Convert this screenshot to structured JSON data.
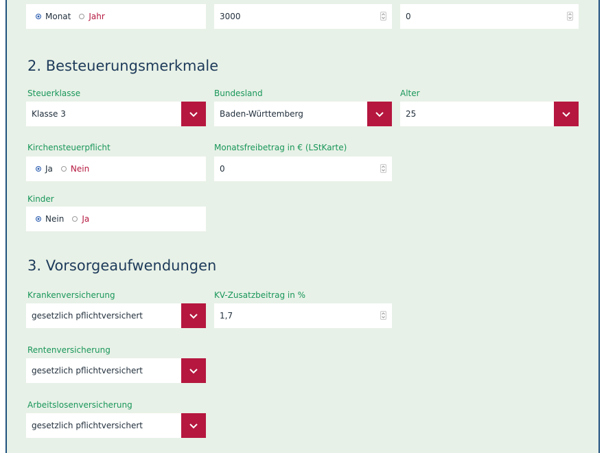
{
  "section1": {
    "period": {
      "options": [
        "Monat",
        "Jahr"
      ],
      "selected": "Monat"
    },
    "salary": "3000",
    "other": "0"
  },
  "section2": {
    "title": "2. Besteuerungsmerkmale",
    "steuerklasse": {
      "label": "Steuerklasse",
      "value": "Klasse 3"
    },
    "bundesland": {
      "label": "Bundesland",
      "value": "Baden-Württemberg"
    },
    "alter": {
      "label": "Alter",
      "value": "25"
    },
    "kirchensteuer": {
      "label": "Kirchensteuerpflicht",
      "options": [
        "Ja",
        "Nein"
      ],
      "selected": "Ja"
    },
    "freibetrag": {
      "label": "Monatsfreibetrag in € (LStKarte)",
      "value": "0"
    },
    "kinder": {
      "label": "Kinder",
      "options": [
        "Nein",
        "Ja"
      ],
      "selected": "Nein"
    }
  },
  "section3": {
    "title": "3. Vorsorgeaufwendungen",
    "kranken": {
      "label": "Krankenversicherung",
      "value": "gesetzlich pflichtversichert"
    },
    "kvzusatz": {
      "label": "KV-Zusatzbeitrag in %",
      "value": "1,7"
    },
    "renten": {
      "label": "Rentenversicherung",
      "value": "gesetzlich pflichtversichert"
    },
    "arbeitslosen": {
      "label": "Arbeitslosenversicherung",
      "value": "gesetzlich pflichtversichert"
    }
  },
  "colors": {
    "accent": "#b5173f",
    "label": "#18965a",
    "heading": "#1d3a5a",
    "background": "#e8f1e7",
    "border": "#1d4f7c"
  },
  "icons": {
    "dropdown": "chevron-down-icon",
    "spinner": "spinner-arrows-icon"
  }
}
